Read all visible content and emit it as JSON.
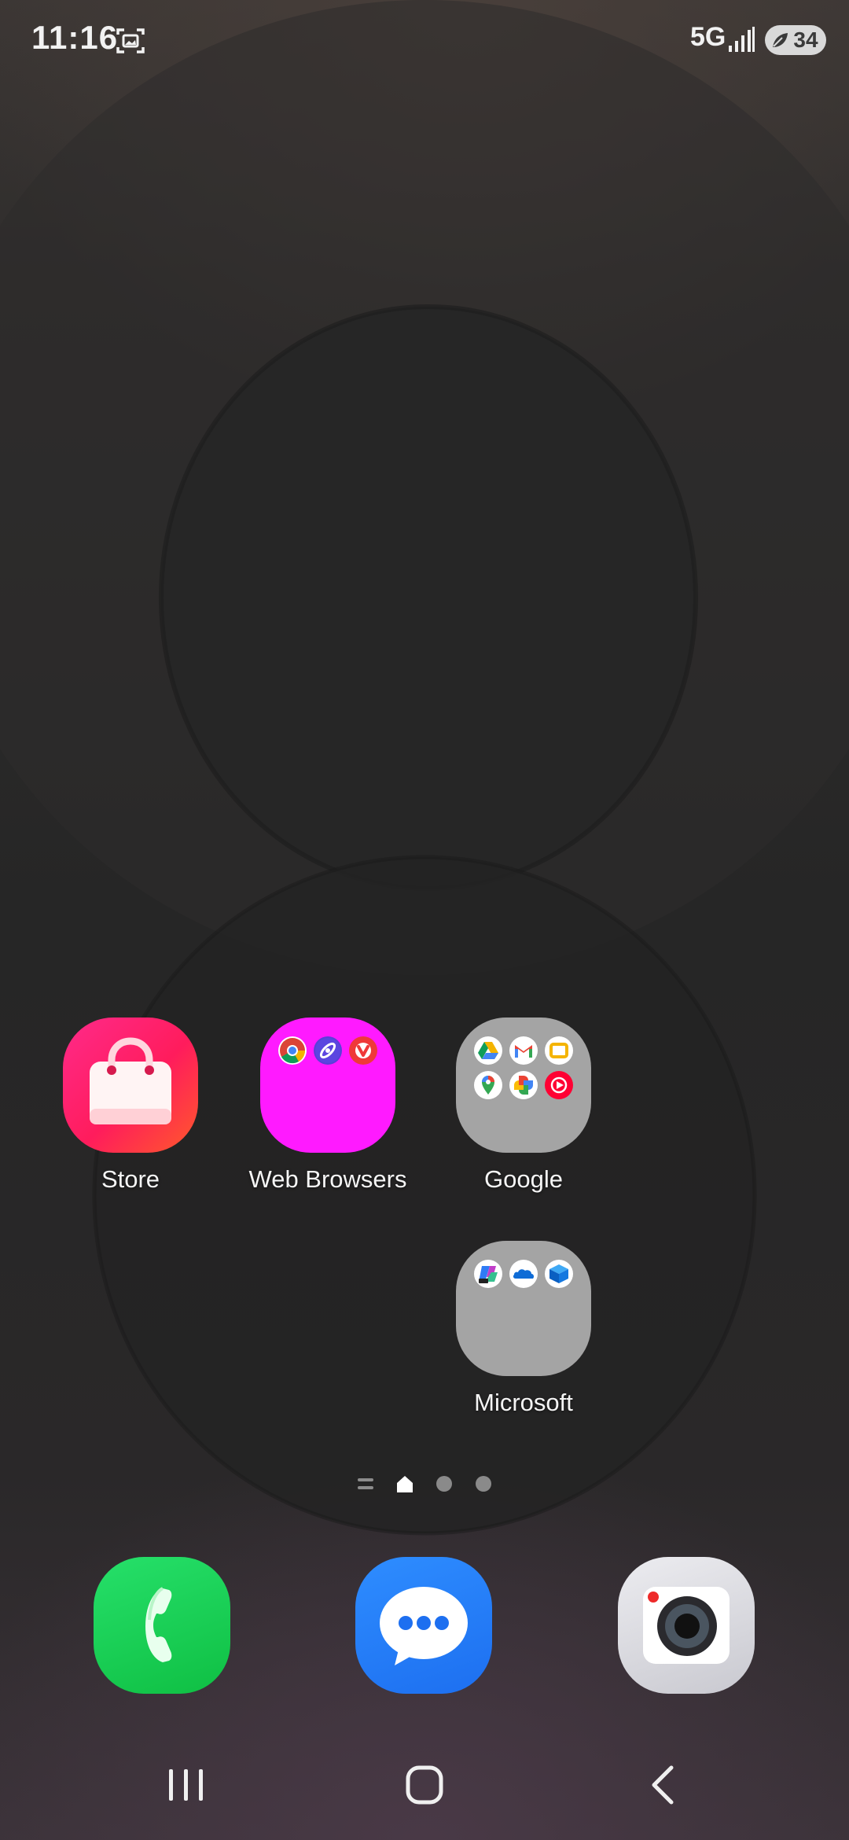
{
  "status_bar": {
    "time": "11:16",
    "network": "5G",
    "battery": "34",
    "icons": [
      "screenshot-icon",
      "signal-icon",
      "battery-icon"
    ]
  },
  "home_apps": [
    {
      "label": "Store",
      "icon": "store-icon"
    },
    {
      "label": "Web Browsers",
      "icon": "folder-icon",
      "contains": [
        "chrome-icon",
        "browser-icon",
        "vivaldi-icon"
      ]
    },
    {
      "label": "Google",
      "icon": "folder-icon",
      "contains": [
        "drive-icon",
        "gmail-icon",
        "slides-icon",
        "maps-icon",
        "photos-icon",
        "youtube-music-icon"
      ]
    },
    {
      "label": "Microsoft",
      "icon": "folder-icon",
      "contains": [
        "copilot-icon",
        "onedrive-icon",
        "authenticator-icon"
      ]
    }
  ],
  "page_indicator": {
    "pages": 3,
    "current": "home"
  },
  "dock": [
    "phone-icon",
    "messages-icon",
    "camera-icon"
  ],
  "nav_bar": [
    "recents-button",
    "home-button",
    "back-button"
  ],
  "colors": {
    "store": "#ff1c5c",
    "web_browsers_folder": "#ff1aff",
    "folder_gray": "#a4a4a4",
    "phone": "#16c94e",
    "messages": "#2179f5",
    "camera": "#e2e2e6"
  }
}
